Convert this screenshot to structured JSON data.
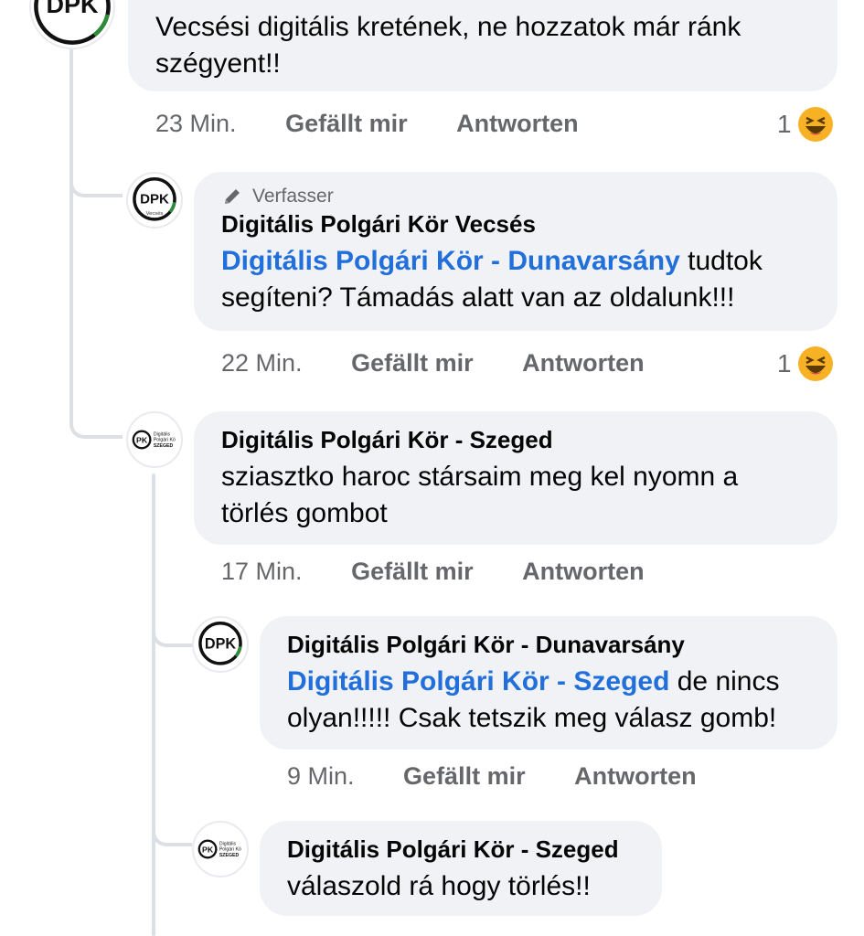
{
  "comments": [
    {
      "time": "23 Min.",
      "text": "Vecsési digitális kretének, ne hozzatok már ránk szégyent!!",
      "like": "Gefällt mir",
      "reply": "Antworten",
      "reactions": {
        "count": "1",
        "icon": "haha-emoji-icon"
      }
    },
    {
      "author_badge": "Verfasser",
      "name": "Digitális Polgári Kör Vecsés",
      "mention": "Digitális Polgári Kör - Dunavarsány",
      "text": " tudtok segíteni? Támadás alatt van az oldalunk!!!",
      "time": "22 Min.",
      "like": "Gefällt mir",
      "reply": "Antworten",
      "reactions": {
        "count": "1",
        "icon": "haha-emoji-icon"
      }
    },
    {
      "name": "Digitális Polgári Kör - Szeged",
      "text": "sziasztko haroc stársaim meg kel nyomn a törlés gombot",
      "time": "17 Min.",
      "like": "Gefällt mir",
      "reply": "Antworten"
    },
    {
      "name": "Digitális Polgári Kör - Dunavarsány",
      "mention": "Digitális Polgári Kör - Szeged",
      "text": " de nincs olyan!!!!! Csak tetszik meg válasz gomb!",
      "time": "9 Min.",
      "like": "Gefällt mir",
      "reply": "Antworten"
    },
    {
      "name": "Digitális Polgári Kör - Szeged",
      "text": "válaszold rá hogy törlés!!"
    }
  ],
  "avatars": {
    "dpk": "DPK",
    "vecses_caption": "Vecsés",
    "szeged_lines": [
      "Digitális",
      "Polgári Kö",
      "SZEGED"
    ]
  },
  "colors": {
    "bubble": "#f0f2f5",
    "mention": "#216fdb",
    "meta": "#65676b",
    "thread": "#dcdfe3"
  }
}
